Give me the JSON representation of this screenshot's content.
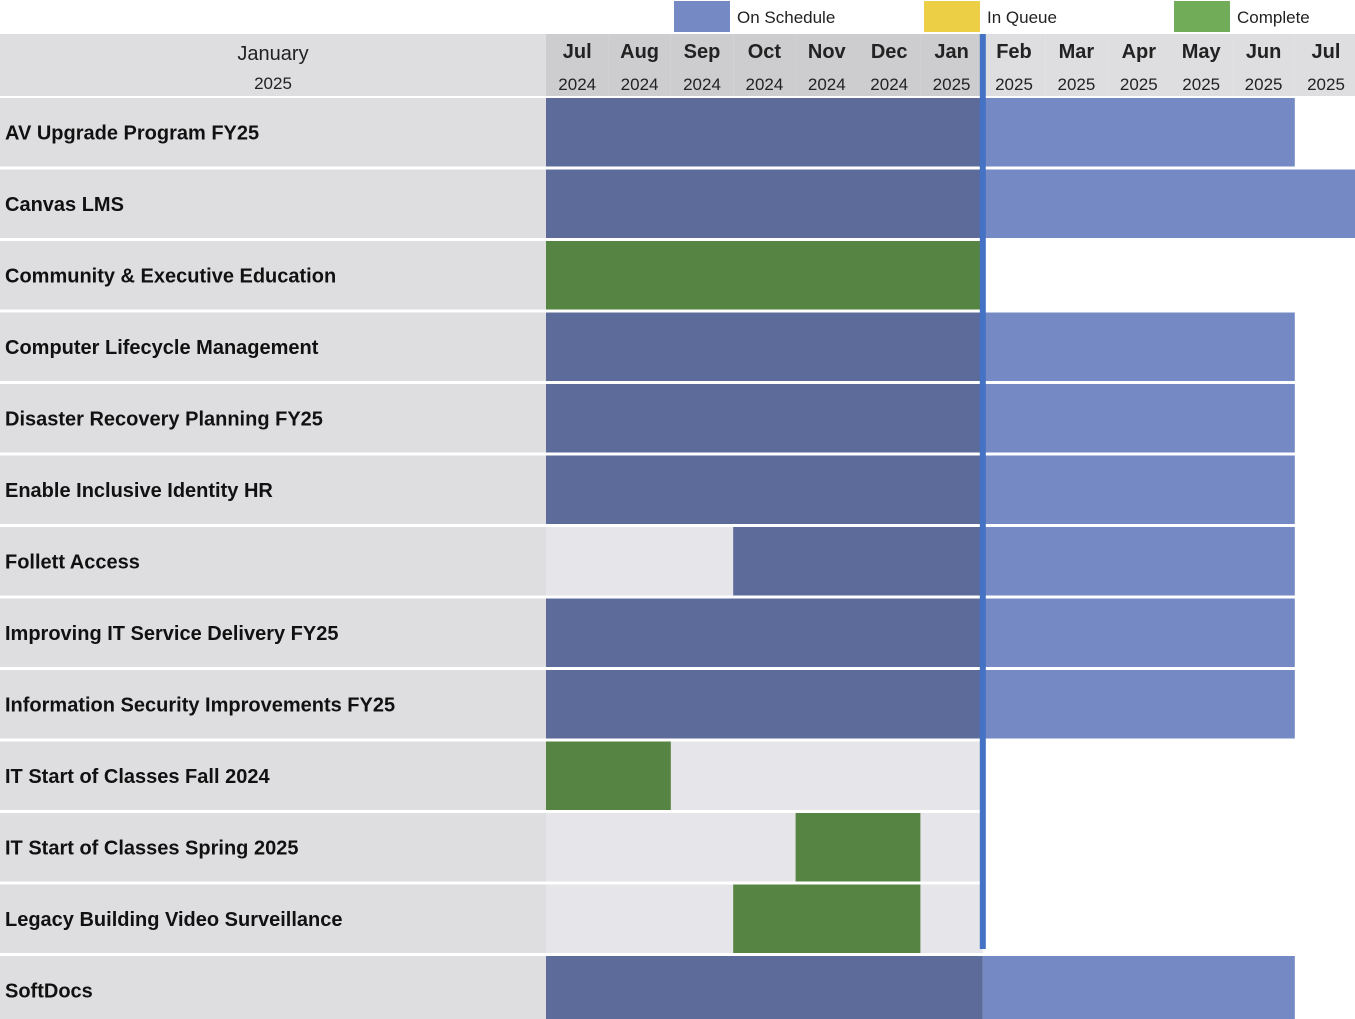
{
  "chart_data": {
    "type": "gantt",
    "header": {
      "month": "January",
      "year": "2025"
    },
    "today_marker": {
      "after_month_index": 6
    },
    "legend": [
      {
        "label": "On Schedule",
        "color": "#7589c5"
      },
      {
        "label": "In Queue",
        "color": "#eccf45"
      },
      {
        "label": "Complete",
        "color": "#71ad58"
      }
    ],
    "months": [
      {
        "month": "Jul",
        "year": "2024"
      },
      {
        "month": "Aug",
        "year": "2024"
      },
      {
        "month": "Sep",
        "year": "2024"
      },
      {
        "month": "Oct",
        "year": "2024"
      },
      {
        "month": "Nov",
        "year": "2024"
      },
      {
        "month": "Dec",
        "year": "2024"
      },
      {
        "month": "Jan",
        "year": "2025"
      },
      {
        "month": "Feb",
        "year": "2025"
      },
      {
        "month": "Mar",
        "year": "2025"
      },
      {
        "month": "Apr",
        "year": "2025"
      },
      {
        "month": "May",
        "year": "2025"
      },
      {
        "month": "Jun",
        "year": "2025"
      },
      {
        "month": "Jul",
        "year": "2025"
      }
    ],
    "colors": {
      "on_schedule_past": "#5c6b99",
      "on_schedule_future": "#7589c5",
      "complete": "#568442",
      "today_line": "#4472c4",
      "row_label_bg": "#dedde0",
      "row_track_bg": "#e6e5ea",
      "header_bg": "#dedde0",
      "header_past_bg": "#cdcdd0"
    },
    "tasks": [
      {
        "name": "AV Upgrade Program FY25",
        "status": "On Schedule",
        "start": 0,
        "end": 12
      },
      {
        "name": "Canvas LMS",
        "status": "On Schedule",
        "start": 0,
        "end": 13
      },
      {
        "name": "Community & Executive Education",
        "status": "Complete",
        "start": 0,
        "end": 7
      },
      {
        "name": "Computer Lifecycle Management",
        "status": "On Schedule",
        "start": 0,
        "end": 12
      },
      {
        "name": "Disaster Recovery Planning FY25",
        "status": "On Schedule",
        "start": 0,
        "end": 12
      },
      {
        "name": "Enable Inclusive Identity HR",
        "status": "On Schedule",
        "start": 0,
        "end": 12
      },
      {
        "name": "Follett Access",
        "status": "On Schedule",
        "start": 3,
        "end": 12
      },
      {
        "name": "Improving IT Service Delivery FY25",
        "status": "On Schedule",
        "start": 0,
        "end": 12
      },
      {
        "name": "Information Security Improvements FY25",
        "status": "On Schedule",
        "start": 0,
        "end": 12
      },
      {
        "name": "IT Start of Classes Fall 2024",
        "status": "Complete",
        "start": 0,
        "end": 2
      },
      {
        "name": "IT Start of Classes Spring 2025",
        "status": "Complete",
        "start": 4,
        "end": 6
      },
      {
        "name": "Legacy Building Video Surveillance",
        "status": "Complete",
        "start": 3,
        "end": 6
      },
      {
        "name": "SoftDocs",
        "status": "On Schedule",
        "start": 0,
        "end": 12
      }
    ]
  }
}
